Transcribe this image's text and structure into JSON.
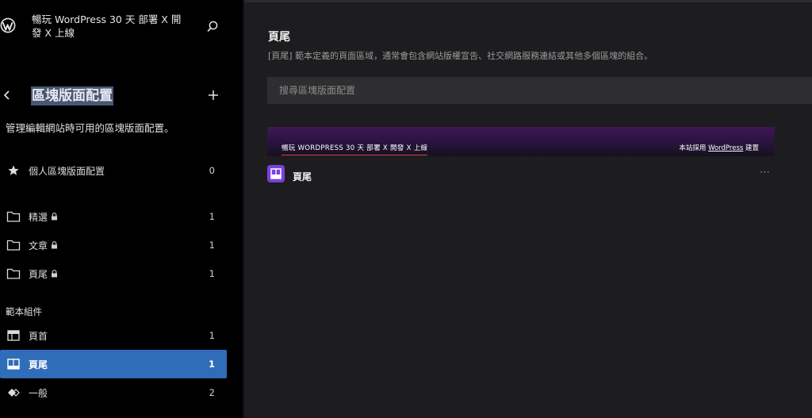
{
  "header": {
    "site_title": "暢玩 WordPress 30 天 部署 X 開發 X 上線"
  },
  "sidebar": {
    "section_title": "區塊版面配置",
    "description": "管理編輯網站時可用的區塊版面配置。",
    "my_patterns": {
      "label": "個人區塊版面配置",
      "count": "0"
    },
    "categories": [
      {
        "label": "精選",
        "count": "1",
        "locked": true
      },
      {
        "label": "文章",
        "count": "1",
        "locked": true
      },
      {
        "label": "頁尾",
        "count": "1",
        "locked": true
      }
    ],
    "template_parts_label": "範本組件",
    "template_parts": [
      {
        "label": "頁首",
        "count": "1",
        "icon": "header-icon"
      },
      {
        "label": "頁尾",
        "count": "1",
        "icon": "footer-icon",
        "active": true
      },
      {
        "label": "一般",
        "count": "2",
        "icon": "general-icon"
      }
    ]
  },
  "main": {
    "title": "頁尾",
    "description": "[頁尾] 範本定義的頁面區域，通常會包含網站版權宣告、社交網路服務連結或其他多個區塊的組合。",
    "search_placeholder": "搜尋區塊版面配置",
    "patterns": [
      {
        "name": "頁尾",
        "preview_title": "暢玩 WORDPRESS 30 天 部署 X 開發 X 上線",
        "preview_credit_prefix": "本站採用 ",
        "preview_credit_link": "WordPress",
        "preview_credit_suffix": " 建置"
      }
    ]
  },
  "colors": {
    "active_item": "#2f6db8",
    "pattern_icon": "#7b3fe4",
    "preview_underline": "#e0434f"
  }
}
